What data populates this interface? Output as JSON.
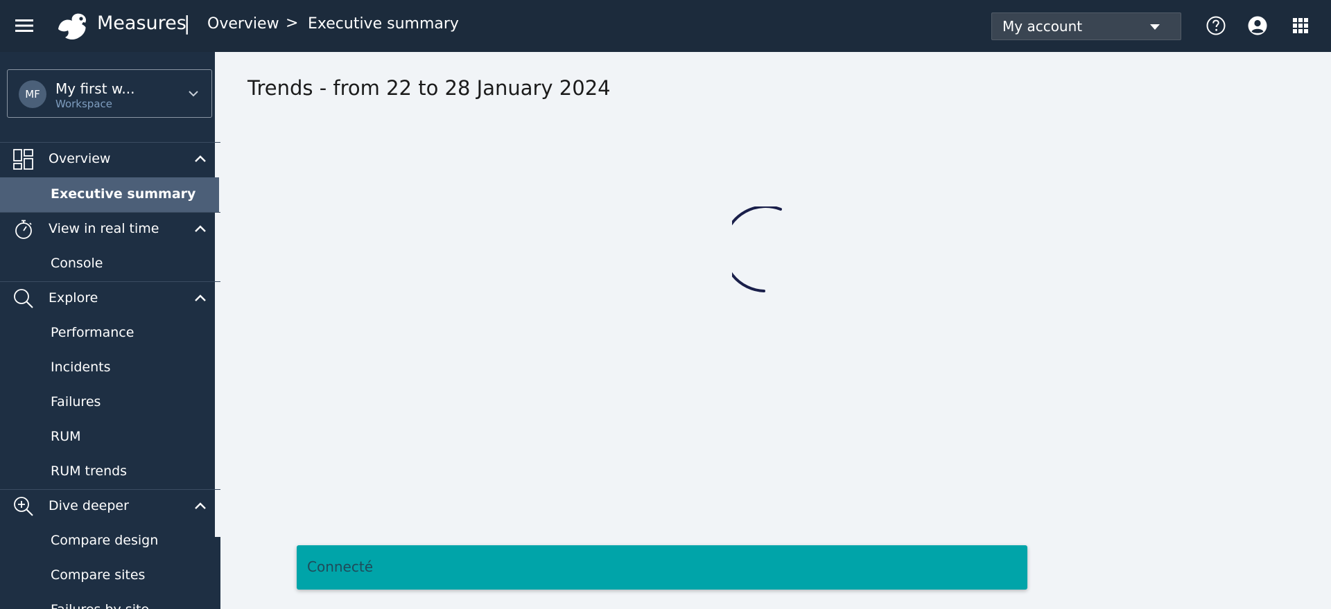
{
  "header": {
    "brand": "Measures",
    "brand_separator": "|",
    "breadcrumb": {
      "items": [
        "Overview",
        "Executive summary"
      ],
      "separator": ">"
    },
    "account_select": {
      "value": "My account"
    },
    "icons": [
      "menu-icon",
      "parrot-logo-icon",
      "help-icon",
      "account-icon",
      "apps-grid-icon"
    ]
  },
  "sidebar": {
    "workspace": {
      "initials": "MF",
      "name": "My first w...",
      "type": "Workspace"
    },
    "sections": [
      {
        "label": "Overview",
        "icon": "dashboard-icon",
        "expanded": true,
        "items": [
          {
            "label": "Executive summary",
            "active": true
          }
        ]
      },
      {
        "label": "View in real time",
        "icon": "stopwatch-icon",
        "expanded": true,
        "items": [
          {
            "label": "Console",
            "active": false
          }
        ]
      },
      {
        "label": "Explore",
        "icon": "search-icon",
        "expanded": true,
        "items": [
          {
            "label": "Performance",
            "active": false
          },
          {
            "label": "Incidents",
            "active": false
          },
          {
            "label": "Failures",
            "active": false
          },
          {
            "label": "RUM",
            "active": false
          },
          {
            "label": "RUM trends",
            "active": false
          }
        ]
      },
      {
        "label": "Dive deeper",
        "icon": "zoom-in-icon",
        "expanded": true,
        "items": [
          {
            "label": "Compare design",
            "active": false
          },
          {
            "label": "Compare sites",
            "active": false
          },
          {
            "label": "Failures by site",
            "active": false
          }
        ]
      }
    ]
  },
  "main": {
    "title": "Trends - from 22 to 28 January 2024",
    "loading": true
  },
  "toast": {
    "message": "Connecté"
  },
  "colors": {
    "topbar_bg": "#1c2b3c",
    "sidebar_bg": "#1e2f43",
    "sidebar_active_bg": "#4c5f78",
    "page_bg": "#f1f4f7",
    "spinner": "#1a1f4a",
    "toast_bg": "#00a4a9"
  }
}
